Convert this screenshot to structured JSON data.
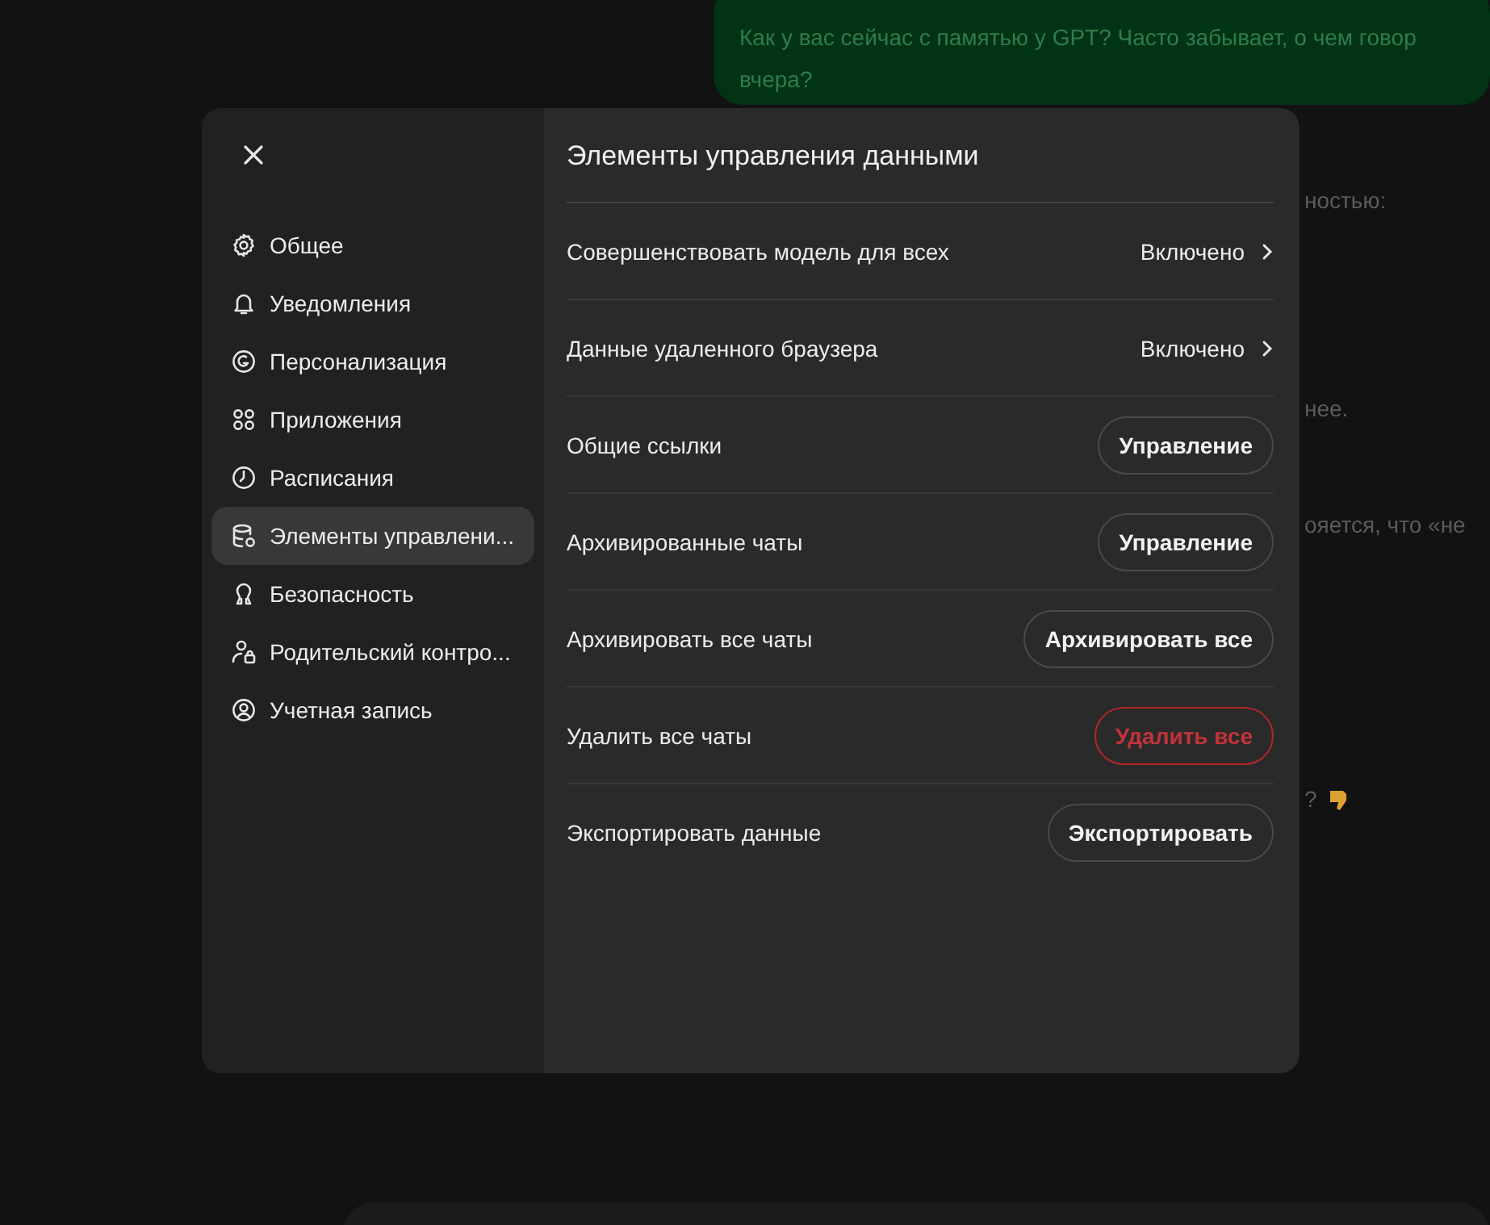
{
  "backdrop": {
    "message": "Как у вас сейчас с памятью у GPT? Часто забывает, о чем говор вчера?",
    "fragments": [
      {
        "text": "ностью:"
      },
      {
        "text": "нее."
      },
      {
        "text": "ояется, что «не"
      },
      {
        "text": "?"
      }
    ]
  },
  "dialog": {
    "title": "Элементы управления данными",
    "sidebar": {
      "items": [
        {
          "label": "Общее",
          "selected": false
        },
        {
          "label": "Уведомления",
          "selected": false
        },
        {
          "label": "Персонализация",
          "selected": false
        },
        {
          "label": "Приложения",
          "selected": false
        },
        {
          "label": "Расписания",
          "selected": false
        },
        {
          "label": "Элементы управлени...",
          "selected": true
        },
        {
          "label": "Безопасность",
          "selected": false
        },
        {
          "label": "Родительский контро...",
          "selected": false
        },
        {
          "label": "Учетная запись",
          "selected": false
        }
      ]
    },
    "rows": [
      {
        "label": "Совершенствовать модель для всех",
        "kind": "link",
        "value": "Включено"
      },
      {
        "label": "Данные удаленного браузера",
        "kind": "link",
        "value": "Включено"
      },
      {
        "label": "Общие ссылки",
        "kind": "button",
        "button": "Управление",
        "danger": false
      },
      {
        "label": "Архивированные чаты",
        "kind": "button",
        "button": "Управление",
        "danger": false
      },
      {
        "label": "Архивировать все чаты",
        "kind": "button",
        "button": "Архивировать все",
        "danger": false
      },
      {
        "label": "Удалить все чаты",
        "kind": "button",
        "button": "Удалить все",
        "danger": true
      },
      {
        "label": "Экспортировать данные",
        "kind": "button",
        "button": "Экспортировать",
        "danger": false
      }
    ]
  }
}
